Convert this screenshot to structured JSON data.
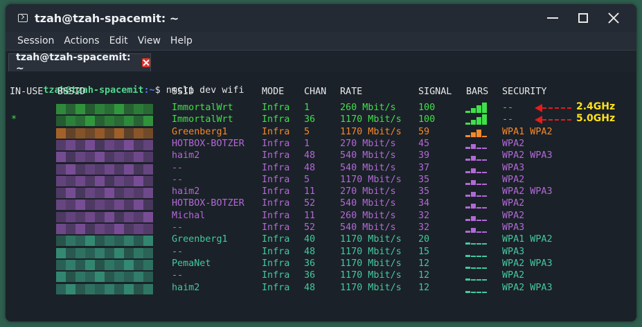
{
  "window": {
    "title": "tzah@tzah-spacemit: ~"
  },
  "menubar": {
    "items": [
      "Session",
      "Actions",
      "Edit",
      "View",
      "Help"
    ]
  },
  "tabs": [
    {
      "label": "tzah@tzah-spacemit: ~"
    }
  ],
  "prompt": {
    "user_host": "tzah@tzah-spacemit",
    "path": ":~",
    "symbol": "$ ",
    "command": "nmcli dev wifi"
  },
  "headers": {
    "in_use": "IN-USE",
    "bssid": "BSSID",
    "ssid": "SSID",
    "mode": "MODE",
    "chan": "CHAN",
    "rate": "RATE",
    "signal": "SIGNAL",
    "bars": "BARS",
    "security": "SECURITY"
  },
  "colors": {
    "green": "#3fe04a",
    "orange": "#f7892a",
    "purple": "#b269d8",
    "teal": "#43c9a0"
  },
  "networks": [
    {
      "in_use": "",
      "ssid": "ImmortalWrt",
      "mode": "Infra",
      "chan": "1",
      "rate": "260 Mbit/s",
      "signal": "100",
      "bars": 4,
      "security": "--",
      "color": "#3fe04a"
    },
    {
      "in_use": "*",
      "ssid": "ImmortalWrt",
      "mode": "Infra",
      "chan": "36",
      "rate": "1170 Mbit/s",
      "signal": "100",
      "bars": 4,
      "security": "--",
      "color": "#3fe04a"
    },
    {
      "in_use": "",
      "ssid": "Greenberg1",
      "mode": "Infra",
      "chan": "5",
      "rate": "1170 Mbit/s",
      "signal": "59",
      "bars": 3,
      "security": "WPA1 WPA2",
      "color": "#f7892a"
    },
    {
      "in_use": "",
      "ssid": "HOTBOX-BOTZER",
      "mode": "Infra",
      "chan": "1",
      "rate": "270 Mbit/s",
      "signal": "45",
      "bars": 2,
      "security": "WPA2",
      "color": "#b269d8"
    },
    {
      "in_use": "",
      "ssid": "haim2",
      "mode": "Infra",
      "chan": "48",
      "rate": "540 Mbit/s",
      "signal": "39",
      "bars": 2,
      "security": "WPA2 WPA3",
      "color": "#b269d8"
    },
    {
      "in_use": "",
      "ssid": "--",
      "mode": "Infra",
      "chan": "48",
      "rate": "540 Mbit/s",
      "signal": "37",
      "bars": 2,
      "security": "WPA3",
      "color": "#b269d8"
    },
    {
      "in_use": "",
      "ssid": "--",
      "mode": "Infra",
      "chan": "5",
      "rate": "1170 Mbit/s",
      "signal": "35",
      "bars": 2,
      "security": "WPA2",
      "color": "#b269d8"
    },
    {
      "in_use": "",
      "ssid": "haim2",
      "mode": "Infra",
      "chan": "11",
      "rate": "270 Mbit/s",
      "signal": "35",
      "bars": 2,
      "security": "WPA2 WPA3",
      "color": "#b269d8"
    },
    {
      "in_use": "",
      "ssid": "HOTBOX-BOTZER",
      "mode": "Infra",
      "chan": "52",
      "rate": "540 Mbit/s",
      "signal": "34",
      "bars": 2,
      "security": "WPA2",
      "color": "#b269d8"
    },
    {
      "in_use": "",
      "ssid": "Michal",
      "mode": "Infra",
      "chan": "11",
      "rate": "260 Mbit/s",
      "signal": "32",
      "bars": 2,
      "security": "WPA2",
      "color": "#b269d8"
    },
    {
      "in_use": "",
      "ssid": "--",
      "mode": "Infra",
      "chan": "52",
      "rate": "540 Mbit/s",
      "signal": "32",
      "bars": 2,
      "security": "WPA3",
      "color": "#b269d8"
    },
    {
      "in_use": "",
      "ssid": "Greenberg1",
      "mode": "Infra",
      "chan": "40",
      "rate": "1170 Mbit/s",
      "signal": "20",
      "bars": 1,
      "security": "WPA1 WPA2",
      "color": "#43c9a0"
    },
    {
      "in_use": "",
      "ssid": "--",
      "mode": "Infra",
      "chan": "48",
      "rate": "1170 Mbit/s",
      "signal": "15",
      "bars": 1,
      "security": "WPA3",
      "color": "#43c9a0"
    },
    {
      "in_use": "",
      "ssid": "PemaNet",
      "mode": "Infra",
      "chan": "36",
      "rate": "1170 Mbit/s",
      "signal": "12",
      "bars": 1,
      "security": "WPA2 WPA3",
      "color": "#43c9a0"
    },
    {
      "in_use": "",
      "ssid": "--",
      "mode": "Infra",
      "chan": "36",
      "rate": "1170 Mbit/s",
      "signal": "12",
      "bars": 1,
      "security": "WPA2",
      "color": "#43c9a0"
    },
    {
      "in_use": "",
      "ssid": "haim2",
      "mode": "Infra",
      "chan": "48",
      "rate": "1170 Mbit/s",
      "signal": "12",
      "bars": 1,
      "security": "WPA2 WPA3",
      "color": "#43c9a0"
    }
  ],
  "annotations": [
    {
      "label": "2.4GHz",
      "row": 0
    },
    {
      "label": "5.0GHz",
      "row": 1
    }
  ]
}
